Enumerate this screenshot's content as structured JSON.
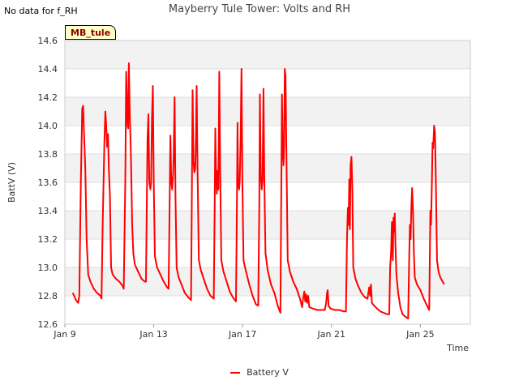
{
  "no_data_note": "No data for f_RH",
  "site_badge": "MB_tule",
  "colors": {
    "series": "#ff0000",
    "band": "#f2f2f2",
    "grid": "#dddddd",
    "axis": "#cccccc"
  },
  "chart_data": {
    "type": "line",
    "title": "Mayberry Tule Tower: Volts and RH",
    "xlabel": "Time",
    "ylabel": "BattV (V)",
    "xlim": [
      9.0,
      27.25
    ],
    "ylim": [
      12.6,
      14.6
    ],
    "x_ticks": [
      {
        "value": 9,
        "label": "Jan 9"
      },
      {
        "value": 13,
        "label": "Jan 13"
      },
      {
        "value": 17,
        "label": "Jan 17"
      },
      {
        "value": 21,
        "label": "Jan 21"
      },
      {
        "value": 25,
        "label": "Jan 25"
      }
    ],
    "y_ticks": [
      12.6,
      12.8,
      13.0,
      13.2,
      13.4,
      13.6,
      13.8,
      14.0,
      14.2,
      14.4,
      14.6
    ],
    "grid": true,
    "legend_position": "bottom-center",
    "series": [
      {
        "name": "Battery V",
        "points": [
          [
            9.35,
            12.82
          ],
          [
            9.42,
            12.8
          ],
          [
            9.5,
            12.77
          ],
          [
            9.6,
            12.75
          ],
          [
            9.65,
            12.8
          ],
          [
            9.72,
            13.6
          ],
          [
            9.78,
            14.12
          ],
          [
            9.82,
            14.14
          ],
          [
            9.86,
            13.95
          ],
          [
            9.92,
            13.7
          ],
          [
            9.98,
            13.2
          ],
          [
            10.05,
            12.95
          ],
          [
            10.15,
            12.9
          ],
          [
            10.3,
            12.85
          ],
          [
            10.45,
            12.82
          ],
          [
            10.6,
            12.8
          ],
          [
            10.65,
            12.78
          ],
          [
            10.7,
            13.3
          ],
          [
            10.78,
            13.9
          ],
          [
            10.82,
            14.1
          ],
          [
            10.86,
            14.0
          ],
          [
            10.9,
            13.85
          ],
          [
            10.94,
            13.94
          ],
          [
            10.98,
            13.7
          ],
          [
            11.03,
            13.5
          ],
          [
            11.08,
            13.0
          ],
          [
            11.15,
            12.95
          ],
          [
            11.3,
            12.92
          ],
          [
            11.45,
            12.9
          ],
          [
            11.6,
            12.87
          ],
          [
            11.65,
            12.85
          ],
          [
            11.72,
            13.6
          ],
          [
            11.76,
            14.38
          ],
          [
            11.79,
            14.2
          ],
          [
            11.82,
            14.0
          ],
          [
            11.85,
            13.98
          ],
          [
            11.88,
            14.44
          ],
          [
            11.92,
            14.1
          ],
          [
            11.97,
            13.8
          ],
          [
            12.03,
            13.3
          ],
          [
            12.08,
            13.1
          ],
          [
            12.15,
            13.02
          ],
          [
            12.3,
            12.97
          ],
          [
            12.45,
            12.92
          ],
          [
            12.6,
            12.9
          ],
          [
            12.65,
            12.9
          ],
          [
            12.72,
            13.9
          ],
          [
            12.76,
            14.08
          ],
          [
            12.8,
            13.6
          ],
          [
            12.85,
            13.55
          ],
          [
            12.88,
            13.6
          ],
          [
            12.92,
            14.05
          ],
          [
            12.96,
            14.28
          ],
          [
            13.0,
            13.6
          ],
          [
            13.05,
            13.08
          ],
          [
            13.15,
            13.0
          ],
          [
            13.3,
            12.95
          ],
          [
            13.45,
            12.9
          ],
          [
            13.6,
            12.86
          ],
          [
            13.67,
            12.85
          ],
          [
            13.72,
            13.5
          ],
          [
            13.75,
            13.93
          ],
          [
            13.79,
            13.6
          ],
          [
            13.83,
            13.55
          ],
          [
            13.87,
            13.65
          ],
          [
            13.9,
            13.8
          ],
          [
            13.94,
            14.2
          ],
          [
            13.98,
            13.5
          ],
          [
            14.03,
            13.0
          ],
          [
            14.12,
            12.93
          ],
          [
            14.25,
            12.88
          ],
          [
            14.4,
            12.82
          ],
          [
            14.55,
            12.79
          ],
          [
            14.68,
            12.77
          ],
          [
            14.72,
            13.6
          ],
          [
            14.75,
            14.25
          ],
          [
            14.79,
            13.75
          ],
          [
            14.83,
            13.67
          ],
          [
            14.87,
            13.7
          ],
          [
            14.9,
            13.9
          ],
          [
            14.93,
            14.28
          ],
          [
            14.97,
            13.7
          ],
          [
            15.03,
            13.05
          ],
          [
            15.12,
            12.98
          ],
          [
            15.25,
            12.92
          ],
          [
            15.4,
            12.85
          ],
          [
            15.55,
            12.8
          ],
          [
            15.7,
            12.78
          ],
          [
            15.74,
            13.4
          ],
          [
            15.77,
            13.98
          ],
          [
            15.8,
            13.7
          ],
          [
            15.84,
            13.52
          ],
          [
            15.87,
            13.68
          ],
          [
            15.91,
            13.55
          ],
          [
            15.95,
            14.38
          ],
          [
            15.99,
            13.7
          ],
          [
            16.04,
            13.05
          ],
          [
            16.14,
            12.97
          ],
          [
            16.28,
            12.9
          ],
          [
            16.42,
            12.83
          ],
          [
            16.56,
            12.79
          ],
          [
            16.7,
            12.76
          ],
          [
            16.74,
            13.4
          ],
          [
            16.77,
            14.02
          ],
          [
            16.8,
            13.6
          ],
          [
            16.84,
            13.55
          ],
          [
            16.87,
            13.6
          ],
          [
            16.91,
            13.9
          ],
          [
            16.95,
            14.4
          ],
          [
            16.99,
            13.6
          ],
          [
            17.04,
            13.05
          ],
          [
            17.14,
            12.98
          ],
          [
            17.3,
            12.88
          ],
          [
            17.45,
            12.8
          ],
          [
            17.6,
            12.74
          ],
          [
            17.7,
            12.73
          ],
          [
            17.75,
            13.4
          ],
          [
            17.78,
            14.22
          ],
          [
            17.82,
            13.65
          ],
          [
            17.86,
            13.55
          ],
          [
            17.9,
            13.62
          ],
          [
            17.94,
            14.26
          ],
          [
            17.98,
            13.6
          ],
          [
            18.03,
            13.1
          ],
          [
            18.13,
            12.98
          ],
          [
            18.28,
            12.88
          ],
          [
            18.43,
            12.82
          ],
          [
            18.58,
            12.73
          ],
          [
            18.7,
            12.68
          ],
          [
            18.74,
            13.5
          ],
          [
            18.77,
            14.22
          ],
          [
            18.81,
            13.8
          ],
          [
            18.84,
            13.72
          ],
          [
            18.87,
            13.85
          ],
          [
            18.9,
            14.4
          ],
          [
            18.93,
            14.35
          ],
          [
            18.97,
            13.8
          ],
          [
            19.03,
            13.05
          ],
          [
            19.13,
            12.97
          ],
          [
            19.28,
            12.9
          ],
          [
            19.43,
            12.85
          ],
          [
            19.58,
            12.78
          ],
          [
            19.68,
            12.72
          ],
          [
            19.72,
            12.78
          ],
          [
            19.78,
            12.83
          ],
          [
            19.82,
            12.76
          ],
          [
            19.86,
            12.81
          ],
          [
            19.9,
            12.75
          ],
          [
            19.95,
            12.8
          ],
          [
            20.0,
            12.72
          ],
          [
            20.15,
            12.71
          ],
          [
            20.35,
            12.7
          ],
          [
            20.55,
            12.7
          ],
          [
            20.7,
            12.7
          ],
          [
            20.76,
            12.75
          ],
          [
            20.8,
            12.82
          ],
          [
            20.83,
            12.84
          ],
          [
            20.87,
            12.73
          ],
          [
            20.95,
            12.71
          ],
          [
            21.15,
            12.7
          ],
          [
            21.35,
            12.7
          ],
          [
            21.55,
            12.69
          ],
          [
            21.65,
            12.69
          ],
          [
            21.7,
            13.2
          ],
          [
            21.74,
            13.42
          ],
          [
            21.77,
            13.3
          ],
          [
            21.8,
            13.62
          ],
          [
            21.83,
            13.27
          ],
          [
            21.86,
            13.72
          ],
          [
            21.9,
            13.78
          ],
          [
            21.94,
            13.55
          ],
          [
            21.98,
            13.0
          ],
          [
            22.08,
            12.92
          ],
          [
            22.2,
            12.87
          ],
          [
            22.35,
            12.82
          ],
          [
            22.5,
            12.79
          ],
          [
            22.62,
            12.78
          ],
          [
            22.66,
            12.82
          ],
          [
            22.7,
            12.86
          ],
          [
            22.74,
            12.8
          ],
          [
            22.78,
            12.88
          ],
          [
            22.82,
            12.75
          ],
          [
            22.92,
            12.73
          ],
          [
            23.05,
            12.71
          ],
          [
            23.2,
            12.69
          ],
          [
            23.35,
            12.68
          ],
          [
            23.5,
            12.67
          ],
          [
            23.6,
            12.67
          ],
          [
            23.64,
            13.0
          ],
          [
            23.68,
            13.1
          ],
          [
            23.72,
            13.32
          ],
          [
            23.76,
            13.05
          ],
          [
            23.79,
            13.35
          ],
          [
            23.82,
            13.25
          ],
          [
            23.85,
            13.38
          ],
          [
            23.88,
            13.15
          ],
          [
            23.92,
            12.95
          ],
          [
            24.0,
            12.82
          ],
          [
            24.1,
            12.72
          ],
          [
            24.2,
            12.67
          ],
          [
            24.35,
            12.65
          ],
          [
            24.45,
            12.64
          ],
          [
            24.5,
            13.1
          ],
          [
            24.53,
            13.3
          ],
          [
            24.56,
            13.2
          ],
          [
            24.6,
            13.45
          ],
          [
            24.63,
            13.56
          ],
          [
            24.67,
            13.4
          ],
          [
            24.71,
            13.1
          ],
          [
            24.75,
            12.93
          ],
          [
            24.85,
            12.88
          ],
          [
            25.0,
            12.84
          ],
          [
            25.15,
            12.78
          ],
          [
            25.3,
            12.73
          ],
          [
            25.4,
            12.7
          ],
          [
            25.45,
            13.4
          ],
          [
            25.48,
            13.3
          ],
          [
            25.52,
            13.6
          ],
          [
            25.55,
            13.88
          ],
          [
            25.58,
            13.84
          ],
          [
            25.62,
            14.0
          ],
          [
            25.66,
            13.95
          ],
          [
            25.7,
            13.6
          ],
          [
            25.75,
            13.05
          ],
          [
            25.82,
            12.97
          ],
          [
            25.9,
            12.93
          ],
          [
            26.0,
            12.9
          ],
          [
            26.07,
            12.88
          ]
        ]
      }
    ]
  }
}
